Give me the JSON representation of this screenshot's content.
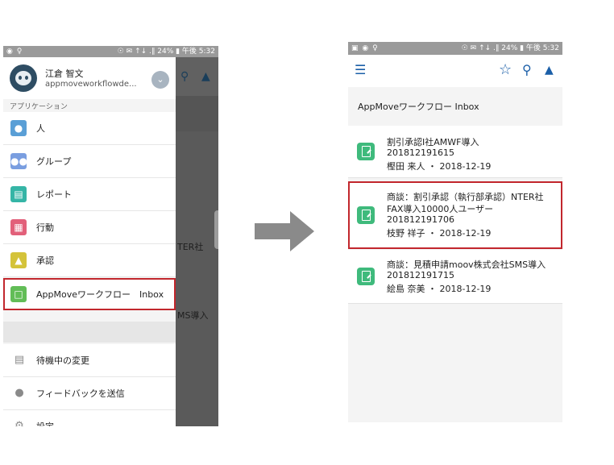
{
  "left_phone": {
    "status_right": "☉ ✉ ↑↓ .∥ 24% ▮ 午後 5:32",
    "status_left": "◉ ♀",
    "user": {
      "name": "江倉 智文",
      "username": "appmoveworkflowde..."
    },
    "section_label": "アプリケーション",
    "menu_items": [
      {
        "label": "人",
        "icon": "person-icon",
        "color": "#5a9fd6"
      },
      {
        "label": "グループ",
        "icon": "group-icon",
        "color": "#7a9ee0"
      },
      {
        "label": "レポート",
        "icon": "report-icon",
        "color": "#35b5a6"
      },
      {
        "label": "行動",
        "icon": "calendar-icon",
        "color": "#e2607a"
      },
      {
        "label": "承認",
        "icon": "approval-icon",
        "color": "#d4c33a"
      },
      {
        "label": "AppMoveワークフロー　Inbox",
        "icon": "workflow-inbox-icon",
        "color": "#62bd57"
      }
    ],
    "util_items": [
      {
        "label": "待機中の変更",
        "icon": "pending-changes-icon"
      },
      {
        "label": "フィードバックを送信",
        "icon": "feedback-icon"
      },
      {
        "label": "設定",
        "icon": "gear-icon"
      }
    ],
    "background_texts": [
      "TER社",
      "MS導入"
    ]
  },
  "right_phone": {
    "status_right": "☉ ✉ ↑↓ .∥ 24% ▮ 午後 5:32",
    "status_left": "▣ ◉ ♀",
    "title": "AppMoveワークフロー Inbox",
    "cards": [
      {
        "lines": [
          "割引承認I社AMWF導入",
          "201812191615",
          "樫田 来人 ・ 2018-12-19"
        ]
      },
      {
        "lines": [
          "商談：割引承認（執行部承認）NTER社",
          "FAX導入10000人ユーザー",
          "201812191706",
          "枝野 祥子 ・ 2018-12-19"
        ]
      },
      {
        "lines": [
          "商談：見積申請moov株式会社SMS導入",
          "201812191715",
          "絵島 奈美 ・ 2018-12-19"
        ]
      }
    ]
  },
  "colors": {
    "highlight": "#c2272d",
    "accent": "#1b5fa8",
    "workflow_green": "#3fba7c",
    "arrow": "#8a8a8a"
  }
}
